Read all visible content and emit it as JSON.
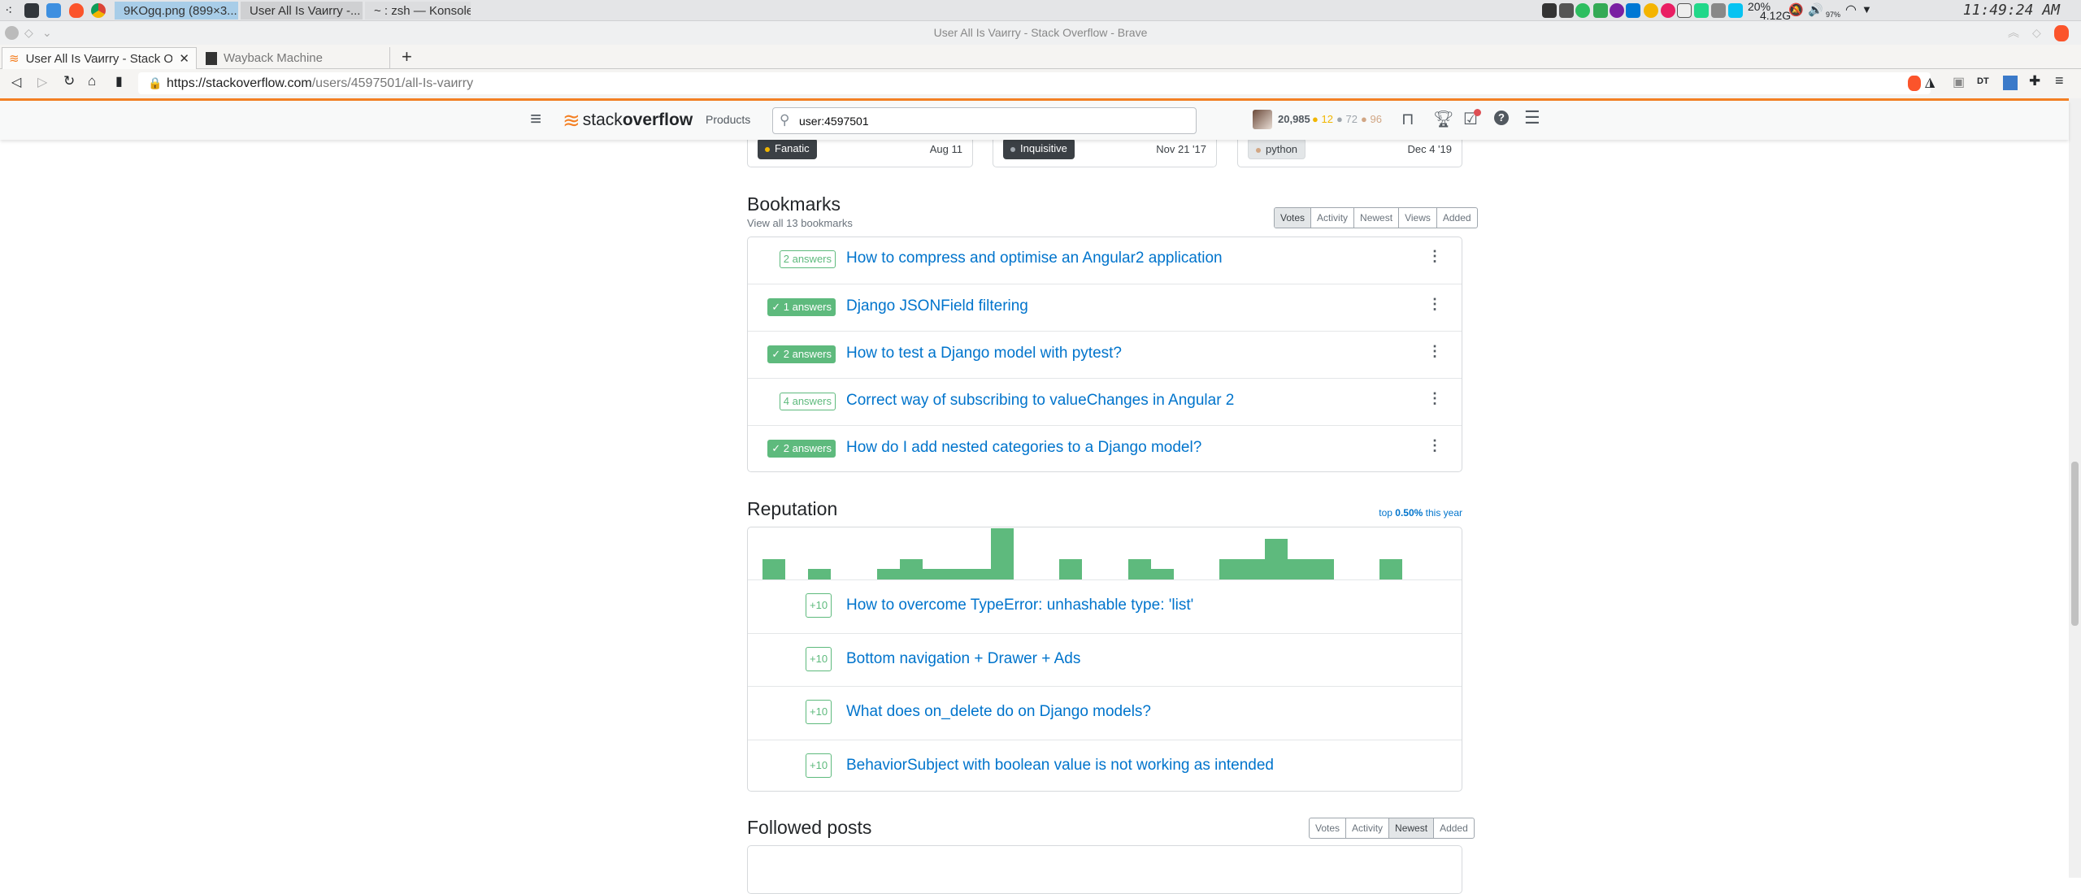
{
  "taskbar": {
    "apps": [
      {
        "label": "9KOgq.png (899×3...",
        "icon": "brave-icon",
        "active": true
      },
      {
        "label": "User All Is Vaиrry -...",
        "icon": "brave-icon",
        "active": false
      },
      {
        "label": "~ : zsh — Konsole",
        "icon": "terminal-icon",
        "active": false
      }
    ],
    "cpu": "20%",
    "mem": "4.12G",
    "battery": "97%",
    "clock": "11:49:24 AM"
  },
  "window": {
    "title": "User All Is Vaиrry - Stack Overflow - Brave"
  },
  "browser": {
    "tabs": [
      {
        "label": "User All Is Vaиrry - Stack Overfl",
        "active": true
      },
      {
        "label": "Wayback Machine",
        "active": false
      }
    ],
    "url_host": "https://stackoverflow.com",
    "url_path": "/users/4597501/all-Is-vaиrry",
    "ext_dt": "DT"
  },
  "so": {
    "logo_a": "stack",
    "logo_b": "overflow",
    "products": "Products",
    "search_value": "user:4597501",
    "reputation": "20,985",
    "gold": "12",
    "silver": "72",
    "bronze": "96",
    "colors": {
      "accent": "#f48024",
      "link": "#0074cc",
      "green": "#5eba7d",
      "gold": "#f1b600",
      "silver": "#9fa6ad",
      "bronze": "#d1a684"
    }
  },
  "badges_cards": [
    {
      "name": "Fanatic",
      "date": "Aug 11",
      "tier": "gold"
    },
    {
      "name": "Inquisitive",
      "date": "Nov 21 '17",
      "tier": "silver"
    },
    {
      "name": "python",
      "date": "Dec 4 '19",
      "tier": "bronze"
    }
  ],
  "bookmarks": {
    "title": "Bookmarks",
    "view_all": "View all 13 bookmarks",
    "sort": [
      "Votes",
      "Activity",
      "Newest",
      "Views",
      "Added"
    ],
    "sort_selected": "Votes",
    "items": [
      {
        "answers": "2 answers",
        "accepted": false,
        "title": "How to compress and optimise an Angular2 application"
      },
      {
        "answers": "1 answers",
        "accepted": true,
        "title": "Django JSONField filtering"
      },
      {
        "answers": "2 answers",
        "accepted": true,
        "title": "How to test a Django model with pytest?"
      },
      {
        "answers": "4 answers",
        "accepted": false,
        "title": "Correct way of subscribing to valueChanges in Angular 2"
      },
      {
        "answers": "2 answers",
        "accepted": true,
        "title": "How do I add nested categories to a Django model?"
      }
    ]
  },
  "reputation": {
    "title": "Reputation",
    "top_prefix": "top ",
    "top_value": "0.50%",
    "top_suffix": " this year",
    "bars": [
      2,
      0,
      1,
      0,
      0,
      1,
      2,
      1,
      1,
      1,
      5,
      0,
      0,
      2,
      0,
      0,
      2,
      1,
      0,
      0,
      2,
      2,
      4,
      2,
      2,
      0,
      0,
      2,
      0,
      0
    ],
    "items": [
      {
        "delta": "+10",
        "title": "How to overcome TypeError: unhashable type: 'list'"
      },
      {
        "delta": "+10",
        "title": "Bottom navigation + Drawer + Ads"
      },
      {
        "delta": "+10",
        "title": "What does on_delete do on Django models?"
      },
      {
        "delta": "+10",
        "title": "BehaviorSubject with boolean value is not working as intended"
      }
    ]
  },
  "followed": {
    "title": "Followed posts",
    "sort": [
      "Votes",
      "Activity",
      "Newest",
      "Added"
    ],
    "sort_selected": "Newest"
  }
}
